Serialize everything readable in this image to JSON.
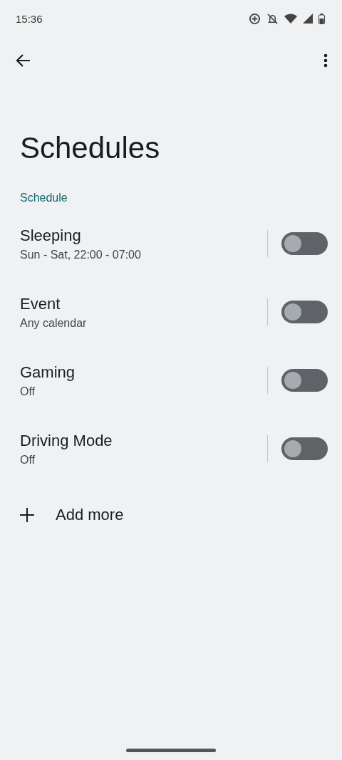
{
  "status_bar": {
    "time": "15:36"
  },
  "title": "Schedules",
  "section": "Schedule",
  "schedules": [
    {
      "name": "Sleeping",
      "detail": "Sun - Sat, 22:00 - 07:00",
      "on": false
    },
    {
      "name": "Event",
      "detail": "Any calendar",
      "on": false
    },
    {
      "name": "Gaming",
      "detail": "Off",
      "on": false
    },
    {
      "name": "Driving Mode",
      "detail": "Off",
      "on": false
    }
  ],
  "add_label": "Add more"
}
